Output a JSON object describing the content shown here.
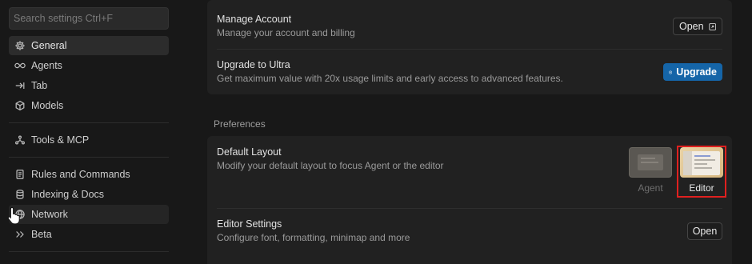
{
  "sidebar": {
    "search_placeholder": "Search settings Ctrl+F",
    "items": [
      {
        "label": "General",
        "icon": "gear-icon"
      },
      {
        "label": "Agents",
        "icon": "infinity-icon"
      },
      {
        "label": "Tab",
        "icon": "tab-arrow-icon"
      },
      {
        "label": "Models",
        "icon": "cube-icon"
      },
      {
        "label": "Tools & MCP",
        "icon": "tools-network-icon"
      },
      {
        "label": "Rules and Commands",
        "icon": "document-icon"
      },
      {
        "label": "Indexing & Docs",
        "icon": "database-icon"
      },
      {
        "label": "Network",
        "icon": "globe-icon"
      },
      {
        "label": "Beta",
        "icon": "double-chevron-icon"
      }
    ]
  },
  "account": {
    "manage_title": "Manage Account",
    "manage_desc": "Manage your account and billing",
    "open_label": "Open",
    "upgrade_title": "Upgrade to Ultra",
    "upgrade_desc": "Get maximum value with 20x usage limits and early access to advanced features.",
    "upgrade_label": "Upgrade"
  },
  "preferences": {
    "section_label": "Preferences",
    "layout_title": "Default Layout",
    "layout_desc": "Modify your default layout to focus Agent or the editor",
    "layout_options": [
      {
        "label": "Agent",
        "selected": false
      },
      {
        "label": "Editor",
        "selected": true
      }
    ],
    "editor_title": "Editor Settings",
    "editor_desc": "Configure font, formatting, minimap and more",
    "editor_open_label": "Open"
  },
  "colors": {
    "accent": "#1565a8",
    "highlight": "#e0201f",
    "background": "#181818",
    "card": "#212121"
  }
}
